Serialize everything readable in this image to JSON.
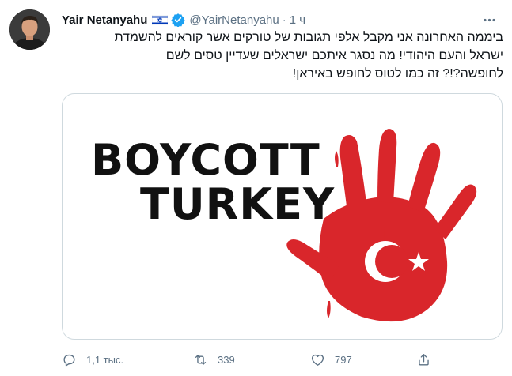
{
  "author": {
    "display_name": "Yair Netanyahu",
    "handle": "@YairNetanyahu",
    "separator": "·",
    "time": "1 ч",
    "flag_icon": "israel-flag-icon",
    "verified_icon": "verified-badge-icon"
  },
  "tweet": {
    "lines": [
      "ביממה האחרונה אני מקבל אלפי תגובות של טורקים אשר קוראים להשמדת",
      "ישראל והעם היהודי! מה נסגר איתכם ישראלים שעדיין טסים לשם",
      "לחופשה?!? זה כמו לטוס לחופש באיראן!"
    ]
  },
  "media": {
    "line1": "BOYCOTT",
    "line2": "TURKEY"
  },
  "actions": {
    "reply_count": "1,1 тыс.",
    "retweet_count": "339",
    "like_count": "797"
  },
  "colors": {
    "accent": "#1da1f2",
    "muted": "#5b7083",
    "hand_red": "#d9262b",
    "border": "#cfd9de"
  }
}
